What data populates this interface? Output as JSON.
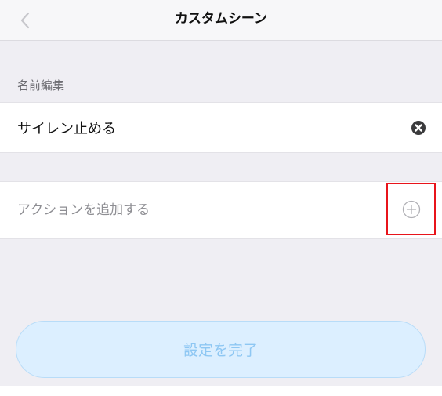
{
  "nav": {
    "title": "カスタムシーン",
    "back_icon": "chevron-left-icon"
  },
  "name_section": {
    "label": "名前編集",
    "value": "サイレン止める",
    "clear_icon": "clear-circle-icon"
  },
  "actions": {
    "label": "アクションを追加する",
    "add_icon": "plus-circle-icon"
  },
  "done_button": {
    "label": "設定を完了"
  },
  "colors": {
    "background": "#efeef3",
    "highlight": "#e8141b",
    "button_fill": "#dcefff",
    "button_text": "#8ec7f3"
  }
}
